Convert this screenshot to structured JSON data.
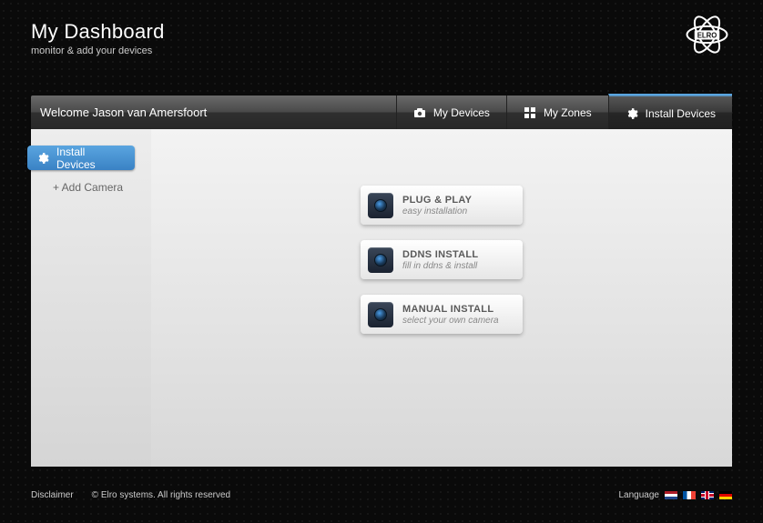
{
  "header": {
    "title": "My Dashboard",
    "subtitle": "monitor & add your devices",
    "brand": "ELRO"
  },
  "navbar": {
    "welcome": "Welcome Jason van Amersfoort",
    "items": [
      {
        "label": "My Devices",
        "icon": "camera-icon",
        "active": false
      },
      {
        "label": "My Zones",
        "icon": "grid-icon",
        "active": false
      },
      {
        "label": "Install Devices",
        "icon": "gear-icon",
        "active": true
      }
    ]
  },
  "sidebar": {
    "active_label": "Install Devices",
    "add_label": "+  Add Camera"
  },
  "options": [
    {
      "title": "PLUG & PLAY",
      "subtitle": "easy installation"
    },
    {
      "title": "DDNS INSTALL",
      "subtitle": "fill in ddns & install"
    },
    {
      "title": "MANUAL INSTALL",
      "subtitle": "select your own camera"
    }
  ],
  "footer": {
    "disclaimer": "Disclaimer",
    "copyright": "©    Elro systems. All rights reserved",
    "language_label": "Language",
    "flags": [
      "nl",
      "fr",
      "uk",
      "de"
    ]
  }
}
